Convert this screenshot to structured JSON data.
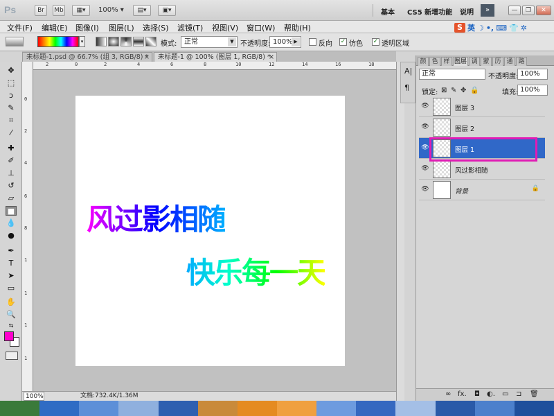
{
  "app": {
    "logo": "Ps",
    "buttons": [
      "Br",
      "Mb"
    ],
    "zoom": "100%",
    "workspaces": [
      "基本",
      "CS5 新增功能",
      "说明"
    ],
    "expand": "»",
    "window_controls": [
      "—",
      "❐",
      "✕"
    ]
  },
  "menu": [
    "文件(F)",
    "编辑(E)",
    "图像(I)",
    "图层(L)",
    "选择(S)",
    "滤镜(T)",
    "视图(V)",
    "窗口(W)",
    "帮助(H)"
  ],
  "ime": {
    "logo": "S",
    "mode": "英"
  },
  "options": {
    "mode_label": "模式:",
    "mode_value": "正常",
    "opacity_label": "不透明度:",
    "opacity_value": "100%",
    "reverse": "反向",
    "dither": "仿色",
    "transparency": "透明区域"
  },
  "tabs": [
    {
      "title": "未标题-1.psd @ 66.7% (组 3, RGB/8) *",
      "close": "×"
    },
    {
      "title": "未标题-1 @ 100% (图层 1, RGB/8) *",
      "close": "×"
    }
  ],
  "canvas": {
    "line1": "风过影相随",
    "line2": "快乐每一天"
  },
  "ruler_top": [
    "2",
    "0",
    "2",
    "4",
    "6",
    "8",
    "10",
    "12",
    "14",
    "16",
    "18"
  ],
  "ruler_left": [
    "0",
    "2",
    "4",
    "6",
    "8",
    "1",
    "1",
    "1",
    "1"
  ],
  "status": {
    "zoom": "100%",
    "doc": "文档:732.4K/1.36M"
  },
  "layers_panel": {
    "tabs": [
      "颜",
      "色",
      "样",
      "图层",
      "调",
      "蒙",
      "历",
      "通",
      "路"
    ],
    "blend_mode": "正常",
    "opacity_label": "不透明度:",
    "opacity_value": "100%",
    "lock_label": "锁定:",
    "fill_label": "填充:",
    "fill_value": "100%",
    "layers": [
      {
        "name": "图层 3"
      },
      {
        "name": "图层 2"
      },
      {
        "name": "图层 1"
      },
      {
        "name": "风过影相随"
      },
      {
        "name": "背景"
      }
    ],
    "footer_icons": [
      "∞",
      "fx.",
      "◘",
      "◐.",
      "▭",
      "⊐",
      "🗑"
    ]
  },
  "colors": {
    "foreground": "#ff00cc",
    "background": "#ffffff",
    "selected_layer": "#3068c8",
    "highlight": "#e01bb4"
  }
}
